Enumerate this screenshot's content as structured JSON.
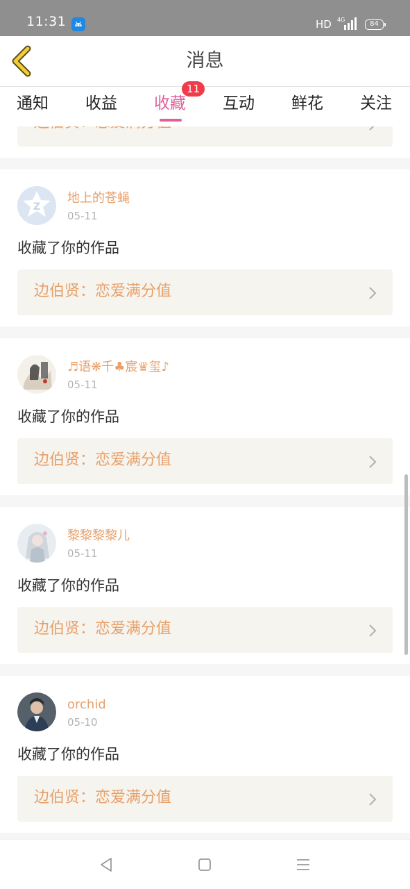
{
  "status_bar": {
    "time": "11:31",
    "network": "HD",
    "signal_type": "4G",
    "battery": "84",
    "app_icon": "android-icon"
  },
  "header": {
    "title": "消息",
    "back_icon": "chevron-left-icon"
  },
  "tabs": [
    {
      "label": "通知",
      "active": false
    },
    {
      "label": "收益",
      "active": false
    },
    {
      "label": "收藏",
      "active": true,
      "badge": "11"
    },
    {
      "label": "互动",
      "active": false
    },
    {
      "label": "鲜花",
      "active": false
    },
    {
      "label": "关注",
      "active": false
    }
  ],
  "colors": {
    "accent": "#e0609a",
    "name_orange": "#e8a06a",
    "badge_red": "#ef3b4a",
    "card_link_bg": "#f5f4ee",
    "divider_bg": "#f6f6f6"
  },
  "partial_top_card": {
    "work_title": "边伯贤：恋爱满分值"
  },
  "messages": [
    {
      "user": "地上的苍蝇",
      "date": "05-11",
      "text": "收藏了你的作品",
      "work_title": "边伯贤：恋爱满分值",
      "avatar": "default-avatar-icon"
    },
    {
      "user": "♬语❋千♣宸♛玺♪",
      "date": "05-11",
      "text": "收藏了你的作品",
      "work_title": "边伯贤：恋爱满分值",
      "avatar": "ink-painting-avatar"
    },
    {
      "user": "黎黎黎黎儿",
      "date": "05-11",
      "text": "收藏了你的作品",
      "work_title": "边伯贤：恋爱满分值",
      "avatar": "anime-girl-avatar"
    },
    {
      "user": "orchid",
      "date": "05-10",
      "text": "收藏了你的作品",
      "work_title": "边伯贤：恋爱满分值",
      "avatar": "photo-avatar"
    }
  ],
  "nav_bar": {
    "back": "triangle-back-icon",
    "home": "square-home-icon",
    "menu": "hamburger-menu-icon"
  }
}
